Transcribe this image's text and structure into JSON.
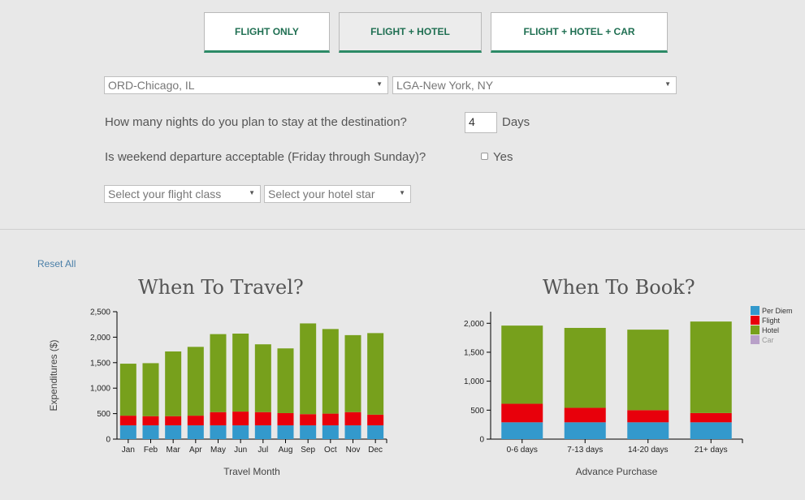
{
  "tabs": [
    {
      "label": "FLIGHT ONLY"
    },
    {
      "label": "FLIGHT + HOTEL"
    },
    {
      "label": "FLIGHT + HOTEL + CAR"
    }
  ],
  "form": {
    "origin": "ORD-Chicago, IL",
    "destination": "LGA-New York, NY",
    "nights_question": "How many nights do you plan to stay at the destination?",
    "nights_value": "4",
    "nights_unit": "Days",
    "weekend_question": "Is weekend departure acceptable (Friday through Sunday)?",
    "weekend_option": "Yes",
    "flight_class_placeholder": "Select your flight class",
    "hotel_star_placeholder": "Select your hotel star"
  },
  "reset_label": "Reset All",
  "colors": {
    "per_diem": "#3399cc",
    "flight": "#e8000b",
    "hotel": "#77a01c",
    "car": "#b8a0c8"
  },
  "chart_data": [
    {
      "type": "bar",
      "stacked": true,
      "title": "When To Travel?",
      "xlabel": "Travel Month",
      "ylabel": "Expenditures ($)",
      "ylim": [
        0,
        2500
      ],
      "yticks": [
        "0",
        "500",
        "1,000",
        "1,500",
        "2,000",
        "2,500"
      ],
      "categories": [
        "Jan",
        "Feb",
        "Mar",
        "Apr",
        "May",
        "Jun",
        "Jul",
        "Aug",
        "Sep",
        "Oct",
        "Nov",
        "Dec"
      ],
      "series": [
        {
          "key": "per_diem",
          "values": [
            270,
            270,
            270,
            270,
            270,
            270,
            270,
            270,
            270,
            270,
            270,
            270
          ]
        },
        {
          "key": "flight",
          "values": [
            190,
            180,
            180,
            190,
            260,
            270,
            260,
            240,
            220,
            230,
            260,
            210
          ]
        },
        {
          "key": "hotel",
          "values": [
            1020,
            1040,
            1270,
            1350,
            1530,
            1530,
            1330,
            1270,
            1780,
            1660,
            1510,
            1600
          ]
        }
      ]
    },
    {
      "type": "bar",
      "stacked": true,
      "title": "When To Book?",
      "xlabel": "Advance Purchase",
      "ylabel": "",
      "ylim": [
        0,
        2200
      ],
      "yticks": [
        "0",
        "500",
        "1,000",
        "1,500",
        "2,000"
      ],
      "categories": [
        "0-6 days",
        "7-13 days",
        "14-20 days",
        "21+ days"
      ],
      "series": [
        {
          "key": "per_diem",
          "name": "Per Diem",
          "values": [
            290,
            290,
            290,
            290
          ]
        },
        {
          "key": "flight",
          "name": "Flight",
          "values": [
            320,
            250,
            210,
            160
          ]
        },
        {
          "key": "hotel",
          "name": "Hotel",
          "values": [
            1350,
            1380,
            1390,
            1580
          ]
        },
        {
          "key": "car",
          "name": "Car",
          "values": [
            0,
            0,
            0,
            0
          ]
        }
      ],
      "legend": [
        "Per Diem",
        "Flight",
        "Hotel",
        "Car"
      ],
      "legend_position": "top-right"
    }
  ]
}
